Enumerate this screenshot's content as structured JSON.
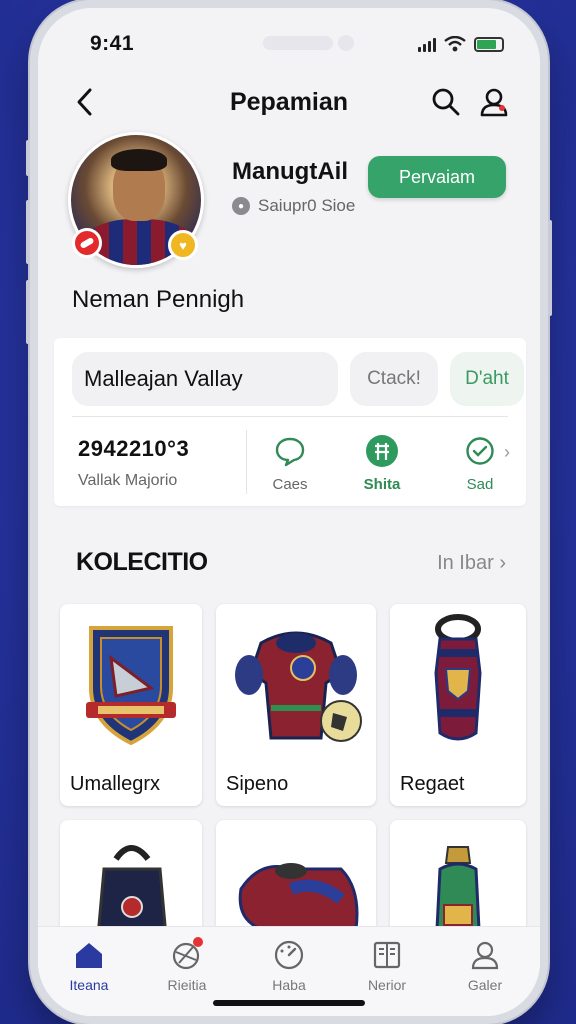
{
  "status_bar": {
    "time": "9:41"
  },
  "header": {
    "title": "Pepamian"
  },
  "profile": {
    "name": "ManugtAil",
    "subtitle": "Saiupr0 Sioe",
    "follow_label": "Pervaiam",
    "full_name": "Neman Pennigh"
  },
  "info_card": {
    "main_pill": "Malleajan Vallay",
    "secondary_pill": "Ctack!",
    "tertiary_pill": "D'aht",
    "stat_value": "2942210°3",
    "stat_label": "Vallak Majorio",
    "actions": [
      {
        "icon": "chat-bubble-icon",
        "label": "Caes"
      },
      {
        "icon": "share-grid-icon",
        "label": "Shita"
      },
      {
        "icon": "check-circle-icon",
        "label": "Sad"
      }
    ]
  },
  "collection": {
    "title": "KOLECITIO",
    "see_all": "In Ibar",
    "items": [
      {
        "label": "Umallegrx",
        "icon": "crest-shield-icon"
      },
      {
        "label": "Sipeno",
        "icon": "armor-suit-icon"
      },
      {
        "label": "Regaet",
        "icon": "vase-trophy-icon"
      },
      {
        "label": "",
        "icon": "backpack-icon"
      },
      {
        "label": "",
        "icon": "boot-icon"
      },
      {
        "label": "",
        "icon": "bottle-icon"
      }
    ]
  },
  "tabbar": {
    "tabs": [
      {
        "label": "Iteana",
        "icon": "home-icon",
        "active": true
      },
      {
        "label": "Rieitia",
        "icon": "ball-icon",
        "active": false
      },
      {
        "label": "Haba",
        "icon": "gauge-icon",
        "active": false
      },
      {
        "label": "Nerior",
        "icon": "book-icon",
        "active": false
      },
      {
        "label": "Galer",
        "icon": "profile-icon",
        "active": false
      }
    ]
  },
  "colors": {
    "accent_green": "#35a36a",
    "brand_blue": "#2a3aa0",
    "background": "#f3f3f6"
  }
}
